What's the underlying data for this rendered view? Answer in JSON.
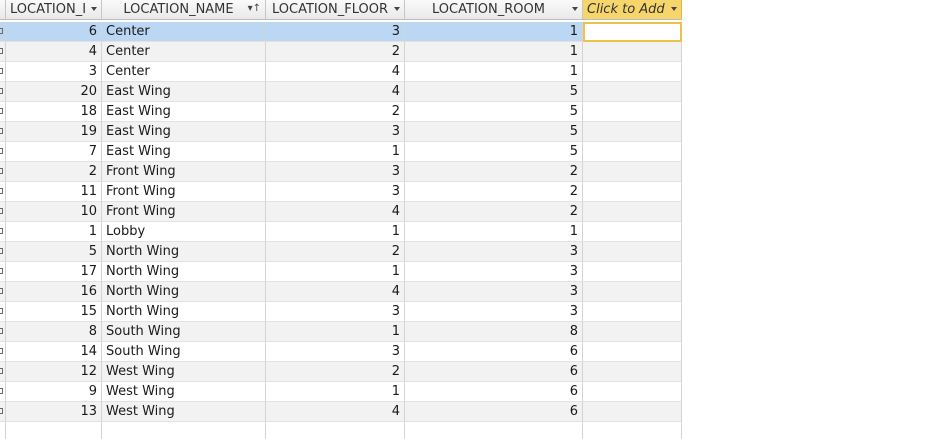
{
  "columns": [
    "LOCATION_I",
    "LOCATION_NAME",
    "LOCATION_FLOOR",
    "LOCATION_ROOM",
    "Click to Add"
  ],
  "sort_icon": "sort-filter-icon",
  "dropdown_icon": "chevron-down-icon",
  "rows": [
    {
      "id": "6",
      "name": "Center",
      "floor": "3",
      "room": "1"
    },
    {
      "id": "4",
      "name": "Center",
      "floor": "2",
      "room": "1"
    },
    {
      "id": "3",
      "name": "Center",
      "floor": "4",
      "room": "1"
    },
    {
      "id": "20",
      "name": "East Wing",
      "floor": "4",
      "room": "5"
    },
    {
      "id": "18",
      "name": "East Wing",
      "floor": "2",
      "room": "5"
    },
    {
      "id": "19",
      "name": "East Wing",
      "floor": "3",
      "room": "5"
    },
    {
      "id": "7",
      "name": "East Wing",
      "floor": "1",
      "room": "5"
    },
    {
      "id": "2",
      "name": "Front Wing",
      "floor": "3",
      "room": "2"
    },
    {
      "id": "11",
      "name": "Front Wing",
      "floor": "3",
      "room": "2"
    },
    {
      "id": "10",
      "name": "Front Wing",
      "floor": "4",
      "room": "2"
    },
    {
      "id": "1",
      "name": "Lobby",
      "floor": "1",
      "room": "1"
    },
    {
      "id": "5",
      "name": "North Wing",
      "floor": "2",
      "room": "3"
    },
    {
      "id": "17",
      "name": "North Wing",
      "floor": "1",
      "room": "3"
    },
    {
      "id": "16",
      "name": "North Wing",
      "floor": "4",
      "room": "3"
    },
    {
      "id": "15",
      "name": "North Wing",
      "floor": "3",
      "room": "3"
    },
    {
      "id": "8",
      "name": "South Wing",
      "floor": "1",
      "room": "8"
    },
    {
      "id": "14",
      "name": "South Wing",
      "floor": "3",
      "room": "6"
    },
    {
      "id": "12",
      "name": "West Wing",
      "floor": "2",
      "room": "6"
    },
    {
      "id": "9",
      "name": "West Wing",
      "floor": "1",
      "room": "6"
    },
    {
      "id": "13",
      "name": "West Wing",
      "floor": "4",
      "room": "6"
    }
  ],
  "selected_row": 0,
  "colors": {
    "selected": "#bcd7f4",
    "header_add": "#f6d66b",
    "alt_row": "#f2f2f2"
  }
}
